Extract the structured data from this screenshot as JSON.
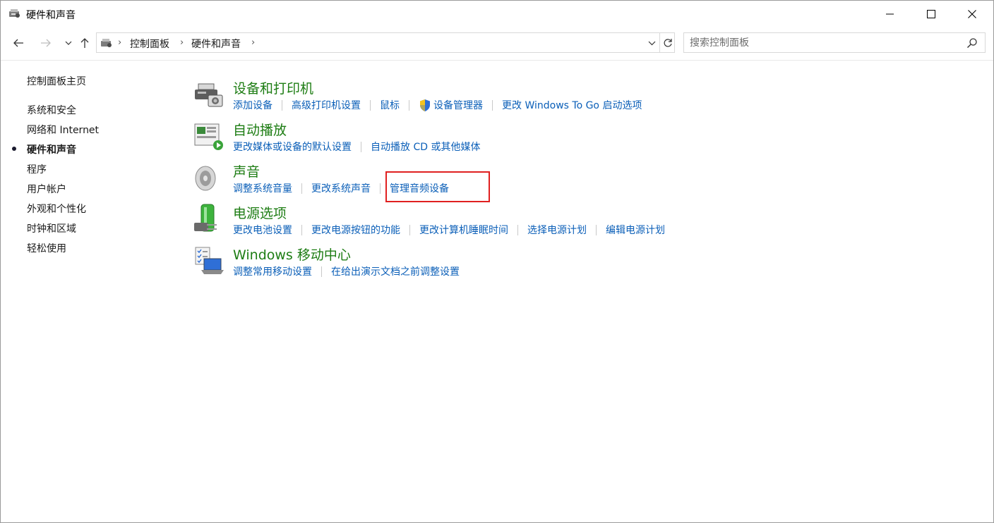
{
  "window": {
    "title": "硬件和声音",
    "title_icon": "hardware-sound-icon"
  },
  "address": {
    "crumbs": [
      "控制面板",
      "硬件和声音"
    ]
  },
  "search": {
    "placeholder": "搜索控制面板"
  },
  "sidebar": {
    "items": [
      {
        "label": "控制面板主页",
        "active": false
      },
      {
        "label": "系统和安全",
        "active": false
      },
      {
        "label": "网络和 Internet",
        "active": false
      },
      {
        "label": "硬件和声音",
        "active": true
      },
      {
        "label": "程序",
        "active": false
      },
      {
        "label": "用户帐户",
        "active": false
      },
      {
        "label": "外观和个性化",
        "active": false
      },
      {
        "label": "时钟和区域",
        "active": false
      },
      {
        "label": "轻松使用",
        "active": false
      }
    ]
  },
  "sections": [
    {
      "title": "设备和打印机",
      "icon": "printer-icon",
      "links": [
        "添加设备",
        "高级打印机设置",
        "鼠标",
        "设备管理器",
        "更改 Windows To Go 启动选项"
      ]
    },
    {
      "title": "自动播放",
      "icon": "autoplay-icon",
      "links": [
        "更改媒体或设备的默认设置",
        "自动播放 CD 或其他媒体"
      ]
    },
    {
      "title": "声音",
      "icon": "speaker-icon",
      "links": [
        "调整系统音量",
        "更改系统声音",
        "管理音频设备"
      ]
    },
    {
      "title": "电源选项",
      "icon": "power-battery-icon",
      "links": [
        "更改电池设置",
        "更改电源按钮的功能",
        "更改计算机睡眠时间",
        "选择电源计划",
        "编辑电源计划"
      ]
    },
    {
      "title": "Windows 移动中心",
      "icon": "mobility-center-icon",
      "links": [
        "调整常用移动设置",
        "在给出演示文档之前调整设置"
      ]
    }
  ],
  "colors": {
    "section_title": "#1e7d14",
    "link": "#0b5fb8",
    "highlight": "#e02020"
  }
}
